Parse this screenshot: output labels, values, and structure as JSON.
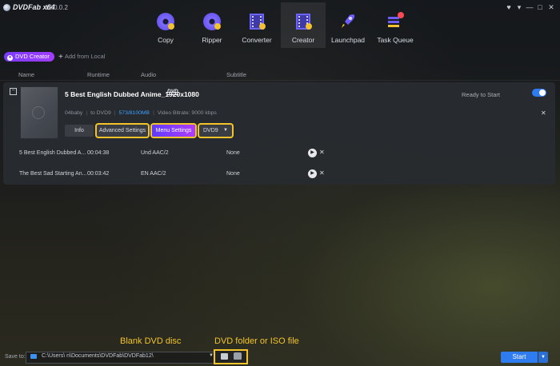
{
  "titlebar": {
    "app_name": "DVDFab x64",
    "version": "12.0.0.2",
    "controls": [
      "♥",
      "▾",
      "—",
      "□",
      "✕"
    ]
  },
  "toolbar": {
    "items": [
      {
        "label": "Copy",
        "icon": "disc-icon"
      },
      {
        "label": "Ripper",
        "icon": "disc-icon"
      },
      {
        "label": "Converter",
        "icon": "film-icon"
      },
      {
        "label": "Creator",
        "icon": "film-icon"
      },
      {
        "label": "Launchpad",
        "icon": "rocket-icon"
      },
      {
        "label": "Task Queue",
        "icon": "queue-icon"
      }
    ],
    "active": "Creator"
  },
  "subbar": {
    "mode_label": "DVD Creator",
    "add_label": "Add from Local"
  },
  "columns": {
    "name": "Name",
    "runtime": "Runtime",
    "audio": "Audio",
    "subtitle": "Subtitle"
  },
  "task": {
    "title": "5 Best English Dubbed Anime_1920x1080",
    "badge": "DVD",
    "status": "Ready to Start",
    "source": "04baby",
    "target": "to DVD9",
    "size": "573/8100MB",
    "bitrate": "Video Bitrate: 9000 kbps",
    "buttons": {
      "info": "Info",
      "advanced": "Advanced Settings",
      "menu": "Menu Settings",
      "disc_type": "DVD9"
    },
    "titles": [
      {
        "name": "5 Best English Dubbed A...",
        "runtime": "00:04:38",
        "audio": "Und  AAC/2",
        "subtitle": "None"
      },
      {
        "name": "The Best Sad Starting An...",
        "runtime": "00:03:42",
        "audio": "EN  AAC/2",
        "subtitle": "None"
      }
    ]
  },
  "annotations": {
    "blank_disc": "Blank DVD disc",
    "folder_iso": "DVD folder or ISO file"
  },
  "bottom": {
    "save_label": "Save to:",
    "save_path": "C:\\Users\\          n\\Documents\\DVDFab\\DVDFab12\\",
    "start_label": "Start"
  },
  "colors": {
    "accent_blue": "#2f7bf0",
    "accent_purple": "#8a3cff",
    "highlight_yellow": "#f3c42a"
  }
}
